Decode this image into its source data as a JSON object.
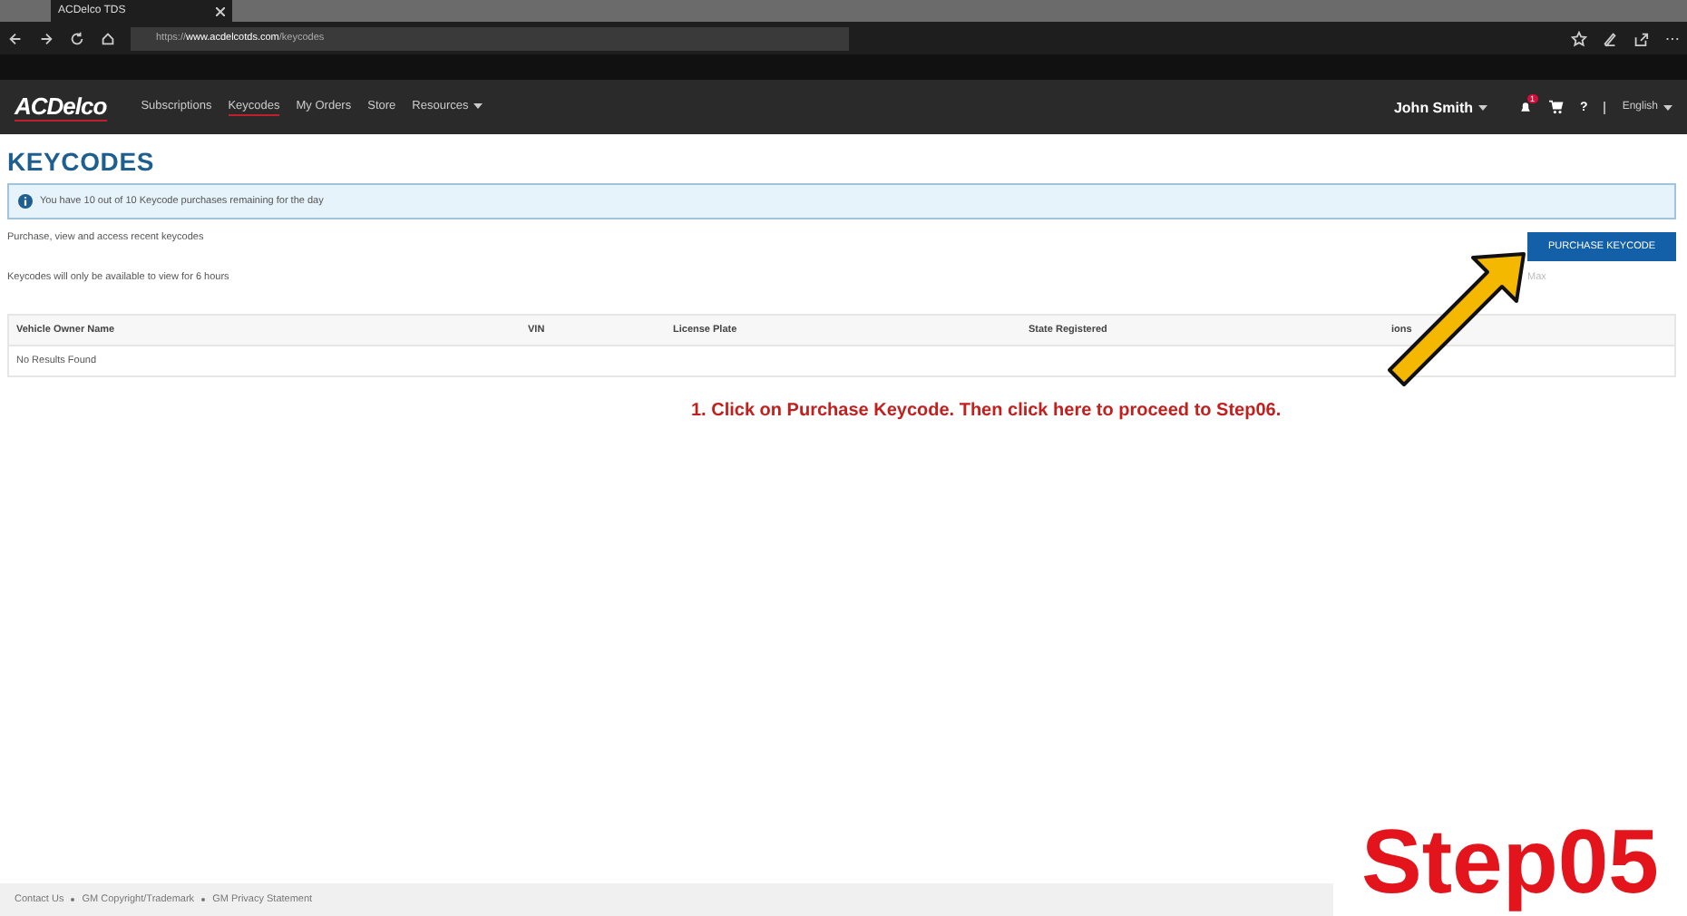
{
  "browser": {
    "tab_title": "ACDelco TDS",
    "url_prefix": "https://",
    "url_host": "www.acdelcotds.com",
    "url_path": "/keycodes"
  },
  "nav": {
    "logo": "ACDelco",
    "items": [
      {
        "label": "Subscriptions",
        "selected": false,
        "dropdown": false
      },
      {
        "label": "Keycodes",
        "selected": true,
        "dropdown": false
      },
      {
        "label": "My Orders",
        "selected": false,
        "dropdown": false
      },
      {
        "label": "Store",
        "selected": false,
        "dropdown": false
      },
      {
        "label": "Resources",
        "selected": false,
        "dropdown": true
      }
    ],
    "user": "John Smith",
    "notification_count": "1",
    "help": "?",
    "language": "English"
  },
  "page": {
    "title": "KEYCODES",
    "alert": "You have 10 out of 10 Keycode purchases remaining for the day",
    "subtitle": "Purchase, view and access recent keycodes",
    "purchase_button": "PURCHASE KEYCODE",
    "max_hint": "Max",
    "notice": "Keycodes will only be available to view for 6 hours"
  },
  "table": {
    "columns": [
      "Vehicle Owner Name",
      "VIN",
      "License Plate",
      "State Registered",
      "ions"
    ],
    "empty_message": "No Results Found"
  },
  "annotation": {
    "instruction": "1. Click on Purchase Keycode. Then click here to proceed to Step06.",
    "step": "Step05"
  },
  "footer": {
    "links": [
      "Contact Us",
      "GM Copyright/Trademark",
      "GM Privacy Statement"
    ]
  }
}
